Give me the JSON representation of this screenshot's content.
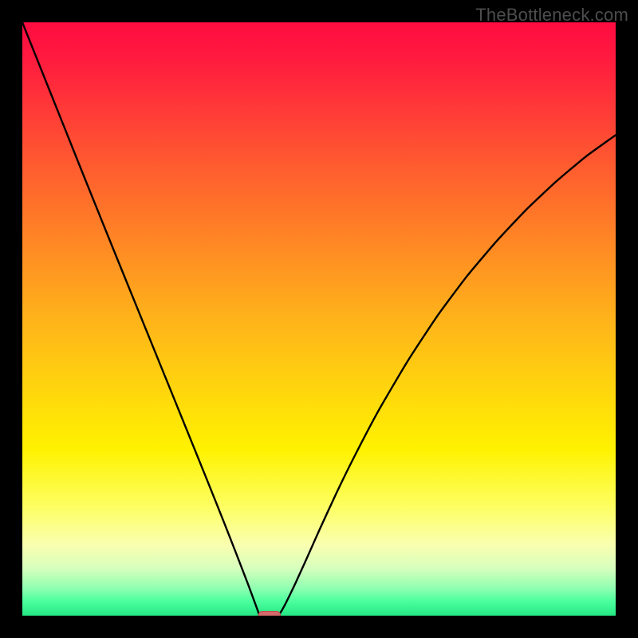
{
  "watermark": "TheBottleneck.com",
  "colors": {
    "gradient_stops": [
      {
        "offset": 0.0,
        "color": "#ff0b40"
      },
      {
        "offset": 0.06,
        "color": "#ff1a3f"
      },
      {
        "offset": 0.2,
        "color": "#ff4d33"
      },
      {
        "offset": 0.35,
        "color": "#ff8026"
      },
      {
        "offset": 0.5,
        "color": "#ffb31a"
      },
      {
        "offset": 0.62,
        "color": "#ffd60d"
      },
      {
        "offset": 0.72,
        "color": "#fff200"
      },
      {
        "offset": 0.82,
        "color": "#fdff66"
      },
      {
        "offset": 0.88,
        "color": "#faffb0"
      },
      {
        "offset": 0.92,
        "color": "#d7ffbd"
      },
      {
        "offset": 0.955,
        "color": "#8cffb0"
      },
      {
        "offset": 0.975,
        "color": "#4dff9e"
      },
      {
        "offset": 1.0,
        "color": "#24e884"
      }
    ],
    "curve": "#000000",
    "marker_fill": "#d46a6a",
    "marker_stroke": "#b94b4b",
    "frame": "#000000"
  },
  "chart_data": {
    "type": "line",
    "title": "",
    "xlabel": "",
    "ylabel": "",
    "xlim": [
      0,
      100
    ],
    "ylim": [
      0,
      100
    ],
    "grid": false,
    "legend": null,
    "curve_points": [
      {
        "x": 0.0,
        "y": 100.0
      },
      {
        "x": 5.0,
        "y": 87.5
      },
      {
        "x": 10.0,
        "y": 75.0
      },
      {
        "x": 15.0,
        "y": 62.6
      },
      {
        "x": 20.0,
        "y": 50.3
      },
      {
        "x": 25.0,
        "y": 38.0
      },
      {
        "x": 28.0,
        "y": 30.6
      },
      {
        "x": 31.0,
        "y": 23.2
      },
      {
        "x": 34.0,
        "y": 15.7
      },
      {
        "x": 36.0,
        "y": 10.6
      },
      {
        "x": 38.0,
        "y": 5.4
      },
      {
        "x": 39.0,
        "y": 2.7
      },
      {
        "x": 39.7,
        "y": 0.8
      },
      {
        "x": 40.0,
        "y": 0.0
      },
      {
        "x": 41.0,
        "y": 0.0
      },
      {
        "x": 42.0,
        "y": 0.0
      },
      {
        "x": 43.0,
        "y": 0.0
      },
      {
        "x": 43.5,
        "y": 0.5
      },
      {
        "x": 44.5,
        "y": 2.3
      },
      {
        "x": 46.0,
        "y": 5.4
      },
      {
        "x": 48.0,
        "y": 9.8
      },
      {
        "x": 50.0,
        "y": 14.3
      },
      {
        "x": 53.0,
        "y": 20.8
      },
      {
        "x": 56.0,
        "y": 26.9
      },
      {
        "x": 60.0,
        "y": 34.5
      },
      {
        "x": 65.0,
        "y": 43.0
      },
      {
        "x": 70.0,
        "y": 50.6
      },
      {
        "x": 75.0,
        "y": 57.3
      },
      {
        "x": 80.0,
        "y": 63.2
      },
      {
        "x": 85.0,
        "y": 68.5
      },
      {
        "x": 90.0,
        "y": 73.2
      },
      {
        "x": 95.0,
        "y": 77.4
      },
      {
        "x": 100.0,
        "y": 81.0
      }
    ],
    "marker": {
      "x_start": 39.8,
      "x_end": 43.5,
      "y": 0.0
    }
  }
}
